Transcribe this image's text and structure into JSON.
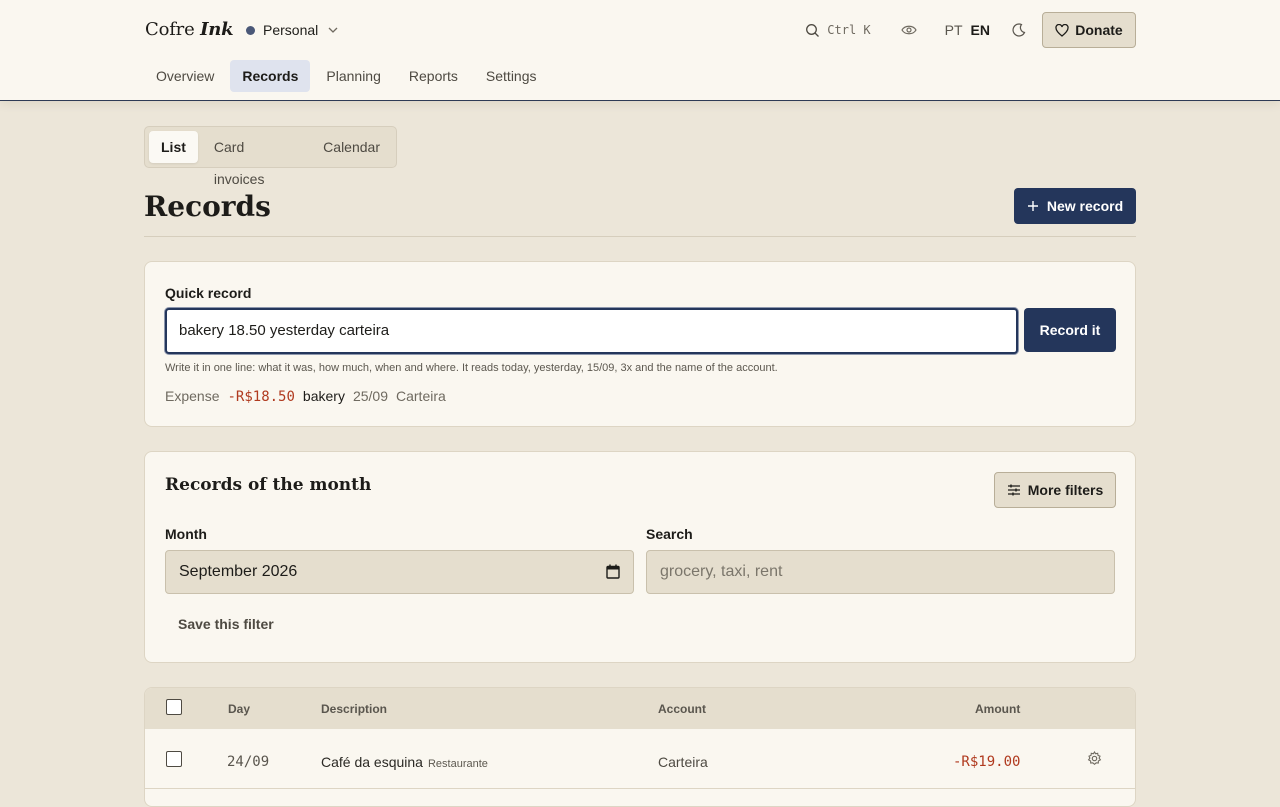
{
  "app": {
    "brand_a": "Cofre",
    "brand_b": "Ink",
    "profile": "Personal",
    "shortcut": "Ctrl K",
    "lang_pt": "PT",
    "lang_en": "EN",
    "donate": "Donate"
  },
  "nav": {
    "overview": "Overview",
    "records": "Records",
    "planning": "Planning",
    "reports": "Reports",
    "settings": "Settings"
  },
  "views": {
    "list": "List",
    "card_invoices": "Card invoices",
    "calendar": "Calendar"
  },
  "page": {
    "title": "Records",
    "new_record": "New record"
  },
  "quick": {
    "label": "Quick record",
    "value": "bakery 18.50 yesterday carteira",
    "button": "Record it",
    "hint": "Write it in one line: what it was, how much, when and where. It reads today, yesterday, 15/09, 3x and the name of the account.",
    "preview": {
      "kind": "Expense",
      "amount": "-R$18.50",
      "description": "bakery",
      "date": "25/09",
      "account": "Carteira"
    }
  },
  "filters": {
    "title": "Records of the month",
    "more": "More filters",
    "month_label": "Month",
    "month_value": "September 2026",
    "search_label": "Search",
    "search_placeholder": "grocery, taxi, rent",
    "save": "Save this filter"
  },
  "table": {
    "headers": {
      "day": "Day",
      "description": "Description",
      "account": "Account",
      "amount": "Amount"
    },
    "rows": [
      {
        "day": "24/09",
        "description": "Café da esquina",
        "category": "Restaurante",
        "account": "Carteira",
        "amount": "-R$19.00"
      }
    ]
  },
  "colors": {
    "accent": "#24365b",
    "negative": "#b03a1f",
    "background": "#ece6d9",
    "surface": "#faf7f0"
  }
}
